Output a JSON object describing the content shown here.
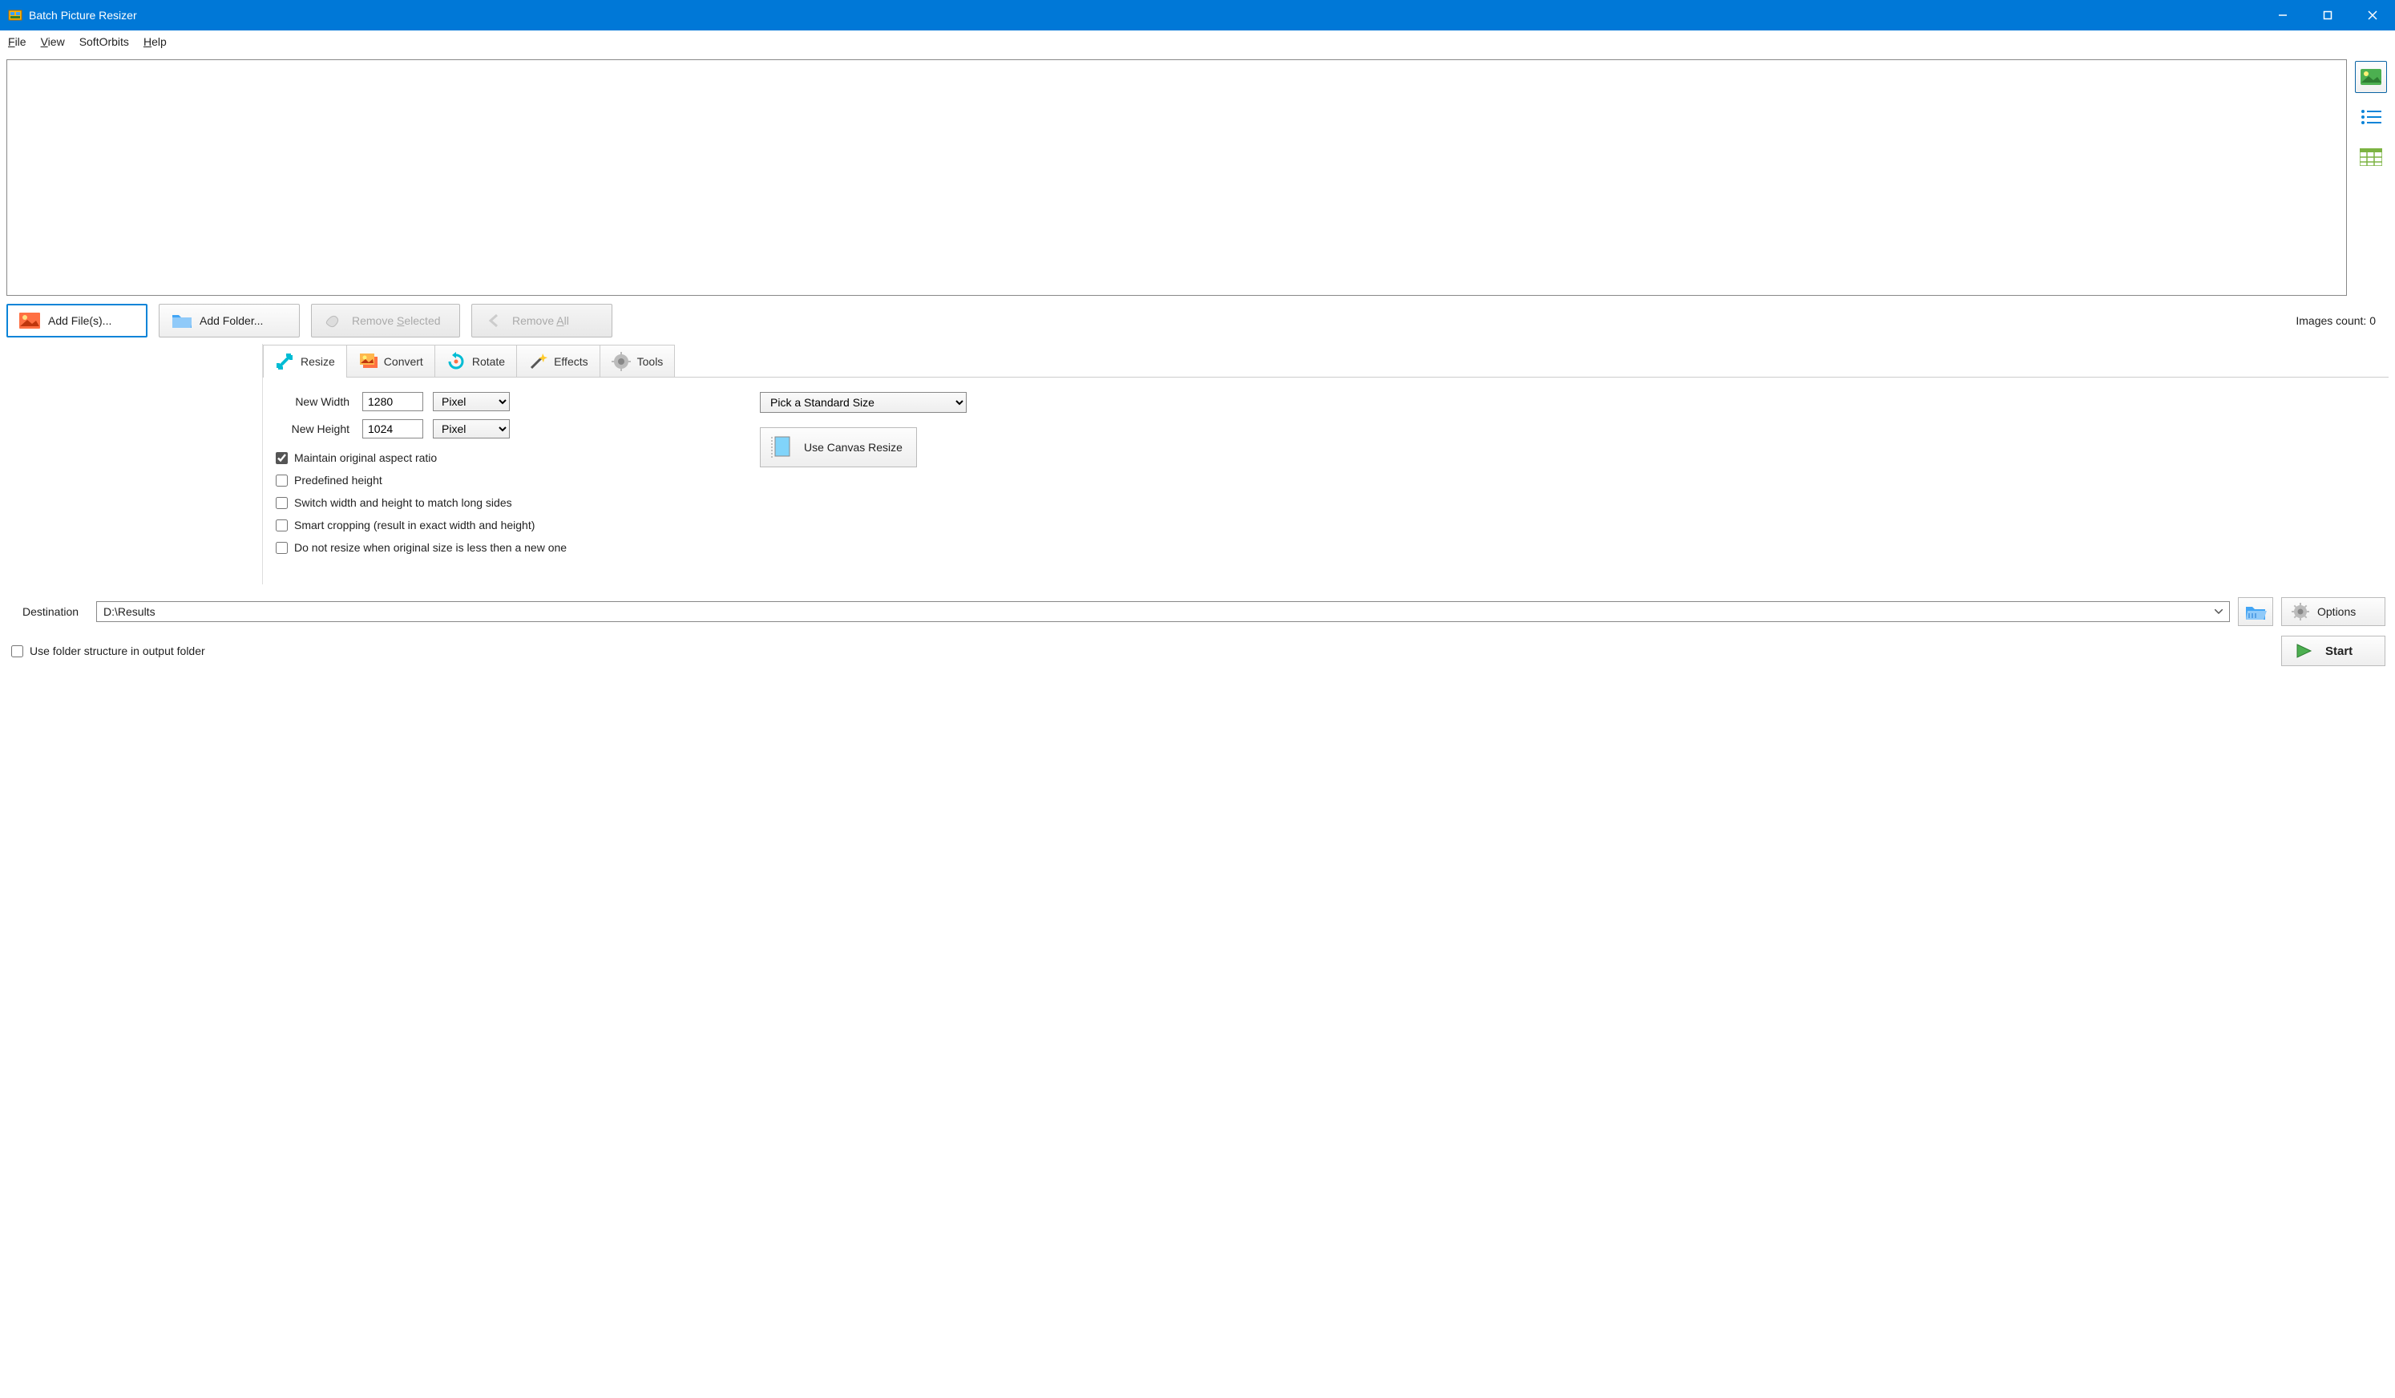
{
  "title": "Batch Picture Resizer",
  "menu": {
    "file": "File",
    "view": "View",
    "softorbits": "SoftOrbits",
    "help": "Help"
  },
  "toolbar": {
    "add_files": "Add File(s)...",
    "add_folder": "Add Folder...",
    "remove_selected": "Remove Selected",
    "remove_all": "Remove All"
  },
  "images_count_label": "Images count: 0",
  "tabs": {
    "resize": "Resize",
    "convert": "Convert",
    "rotate": "Rotate",
    "effects": "Effects",
    "tools": "Tools"
  },
  "resize": {
    "new_width_label": "New Width",
    "new_width_value": "1280",
    "new_height_label": "New Height",
    "new_height_value": "1024",
    "unit_w": "Pixel",
    "unit_h": "Pixel",
    "standard_size": "Pick a Standard Size",
    "canvas_btn": "Use Canvas Resize",
    "chk_aspect": "Maintain original aspect ratio",
    "chk_predef": "Predefined height",
    "chk_switch": "Switch width and height to match long sides",
    "chk_smart": "Smart cropping (result in exact width and height)",
    "chk_noresz": "Do not resize when original size is less then a new one"
  },
  "dest": {
    "label": "Destination",
    "value": "D:\\Results",
    "options": "Options",
    "use_folder_structure": "Use folder structure in output folder",
    "start": "Start"
  }
}
